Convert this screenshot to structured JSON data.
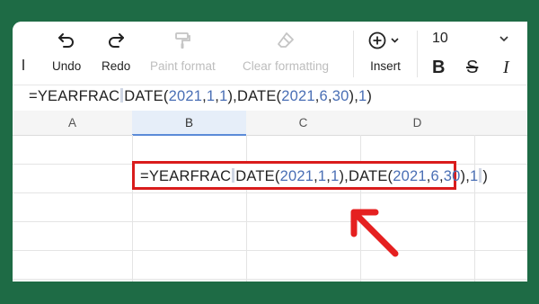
{
  "toolbar": {
    "undo_label": "Undo",
    "redo_label": "Redo",
    "paint_format_label": "Paint format",
    "clear_formatting_label": "Clear formatting",
    "insert_label": "Insert",
    "font_size": "10"
  },
  "formula": {
    "prefix": "=YEARFRAC",
    "date1_open": "DATE(",
    "date1_year": "2021",
    "date1_sep1": ",",
    "date1_month": "1",
    "date1_sep2": ",",
    "date1_day": "1",
    "date1_close": "),",
    "date2_open": "DATE(",
    "date2_year": "2021",
    "date2_sep1": ",",
    "date2_month": "6",
    "date2_sep2": ",",
    "date2_day": "30",
    "date2_close": "),",
    "basis": "1",
    "end": ")"
  },
  "columns": [
    "A",
    "B",
    "C",
    "D"
  ],
  "selected_column": "B",
  "colors": {
    "background": "#1e6b45",
    "highlight_border": "#d91c1c",
    "arrow": "#e52020",
    "number_blue": "#4a6fb5"
  }
}
